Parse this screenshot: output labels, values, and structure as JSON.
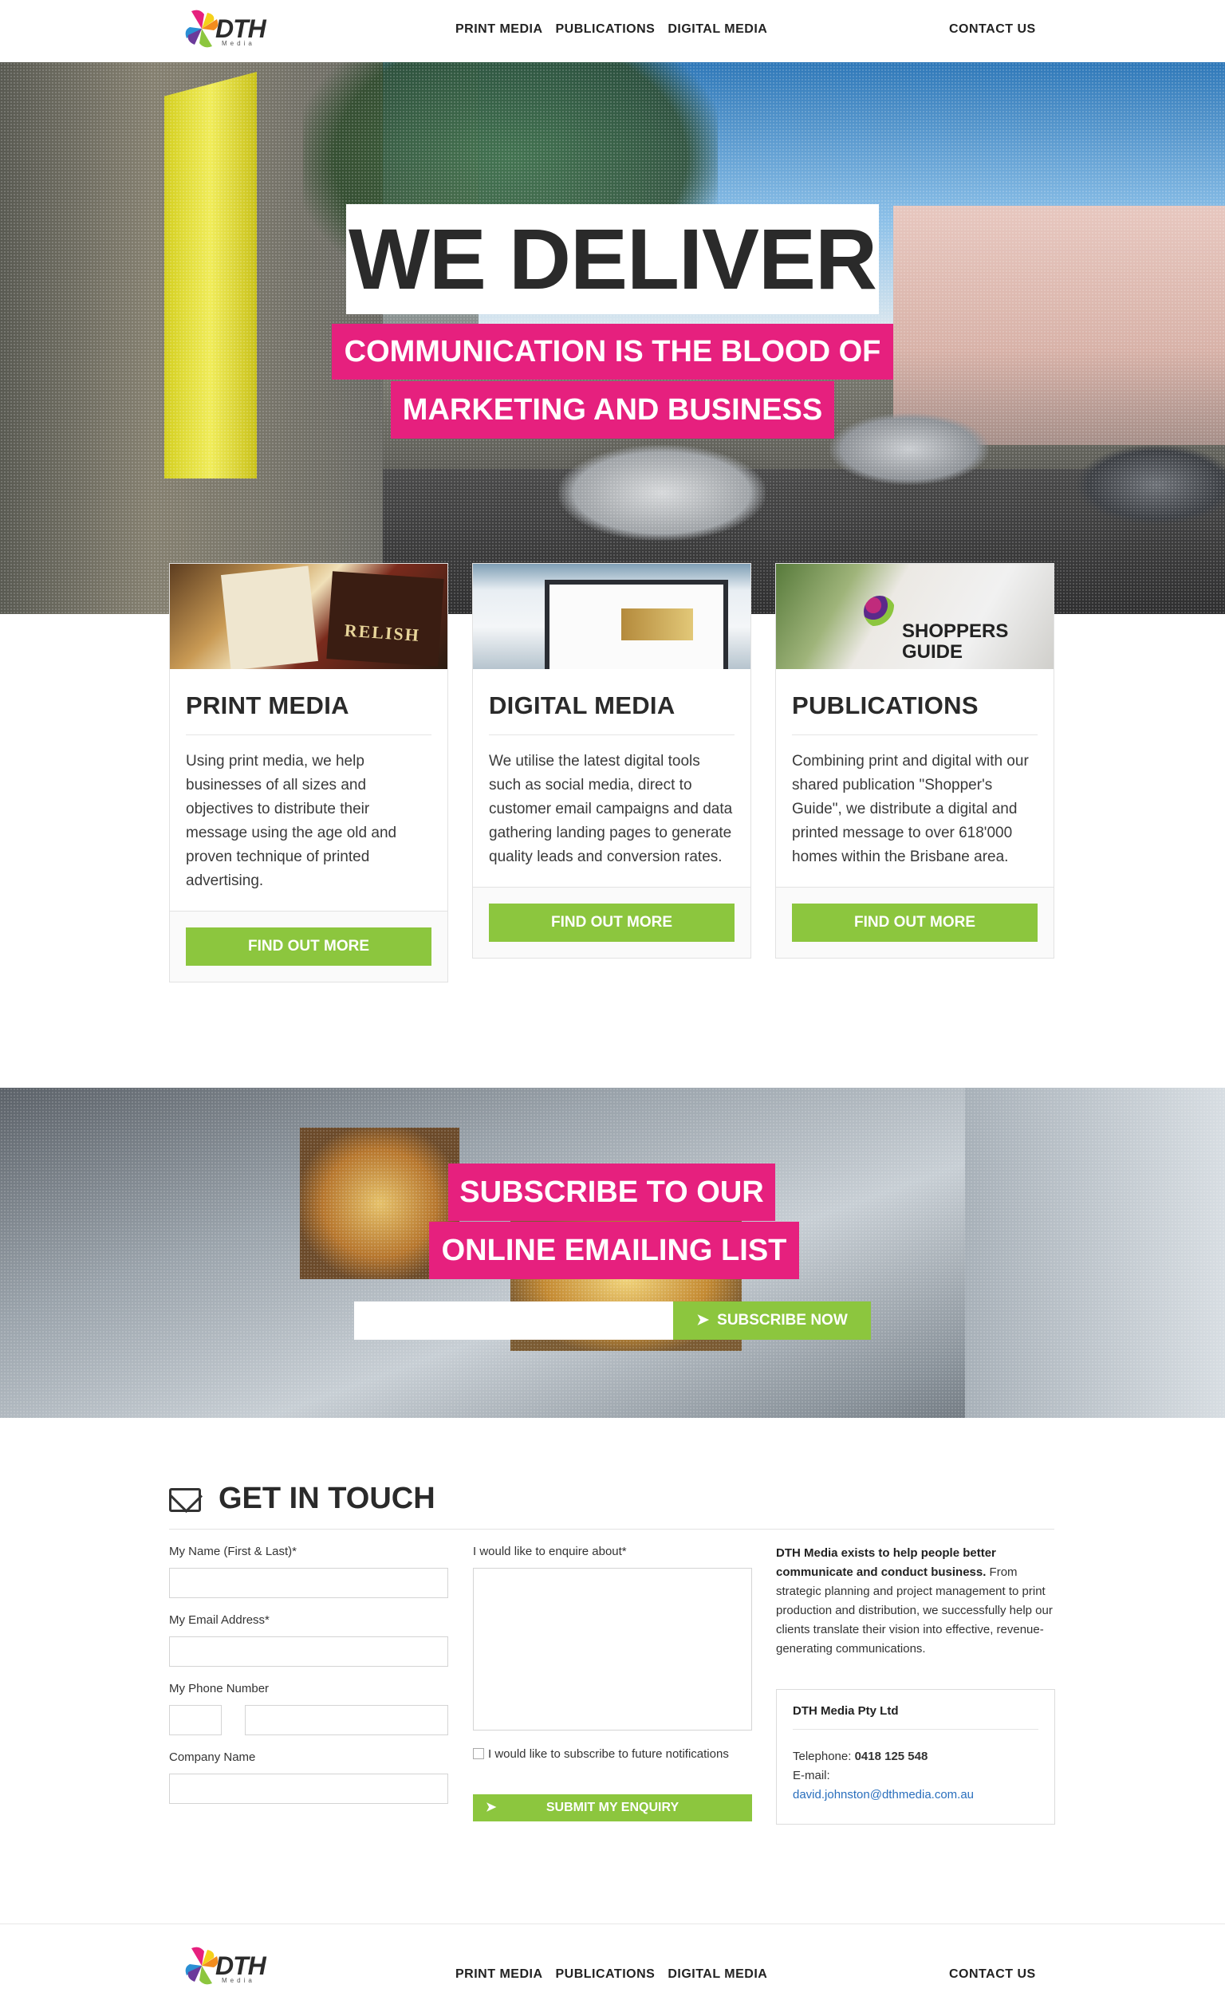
{
  "brand": {
    "name": "DTH",
    "sub": "Media"
  },
  "nav": {
    "links": [
      "PRINT MEDIA",
      "PUBLICATIONS",
      "DIGITAL MEDIA"
    ],
    "contact": "CONTACT US"
  },
  "hero": {
    "title": "WE DELIVER",
    "subtitle_line1": "COMMUNICATION IS THE BLOOD OF",
    "subtitle_line2": "MARKETING AND BUSINESS"
  },
  "cards": [
    {
      "title": "PRINT MEDIA",
      "text": "Using print media, we help businesses of all sizes and objectives to distribute their message using the age old and proven technique of printed advertising.",
      "button": "FIND OUT MORE",
      "image_icon": "restaurant-menu-image",
      "image_text": "RELISH"
    },
    {
      "title": "DIGITAL MEDIA",
      "text": "We utilise the latest digital tools such as social media, direct to customer email campaigns and data gathering landing pages to generate quality leads and conversion rates.",
      "button": "FIND OUT MORE",
      "image_icon": "email-template-screen-image"
    },
    {
      "title": "PUBLICATIONS",
      "text": "Combining print and digital with our shared publication \"Shopper's Guide\", we distribute a digital and printed message to over 618'000 homes within the Brisbane area.",
      "button": "FIND OUT MORE",
      "image_icon": "shoppers-guide-image",
      "image_text": "SHOPPERS GUIDE"
    }
  ],
  "subscribe": {
    "title_line1": "SUBSCRIBE TO OUR",
    "title_line2": "ONLINE EMAILING LIST",
    "input_value": "",
    "button": "SUBSCRIBE NOW",
    "button_icon": "paper-plane-icon"
  },
  "contact": {
    "heading": "GET IN TOUCH",
    "heading_icon": "envelope-icon",
    "name_label": "My Name (First & Last)*",
    "email_label": "My Email Address*",
    "phone_label": "My Phone Number",
    "company_label": "Company Name",
    "enquire_label": "I would like to enquire about*",
    "subscribe_checkbox_label": "I would like to subscribe to future notifications",
    "submit": "SUBMIT MY ENQUIRY",
    "about_bold": "DTH Media exists to help people better communicate and conduct business.",
    "about_rest": " From strategic planning and project management to print production and distribution, we successfully help our clients translate their vision into effective, revenue-generating communications.",
    "company_name": "DTH Media Pty Ltd",
    "telephone_label": "Telephone:",
    "telephone": "0418 125 548",
    "email_field_label": "E-mail:",
    "email": "david.johnston@dthmedia.com.au"
  },
  "colors": {
    "pink": "#e6207e",
    "green": "#8cc63e",
    "dark": "#2a2a2a",
    "link": "#2a6fbd"
  }
}
